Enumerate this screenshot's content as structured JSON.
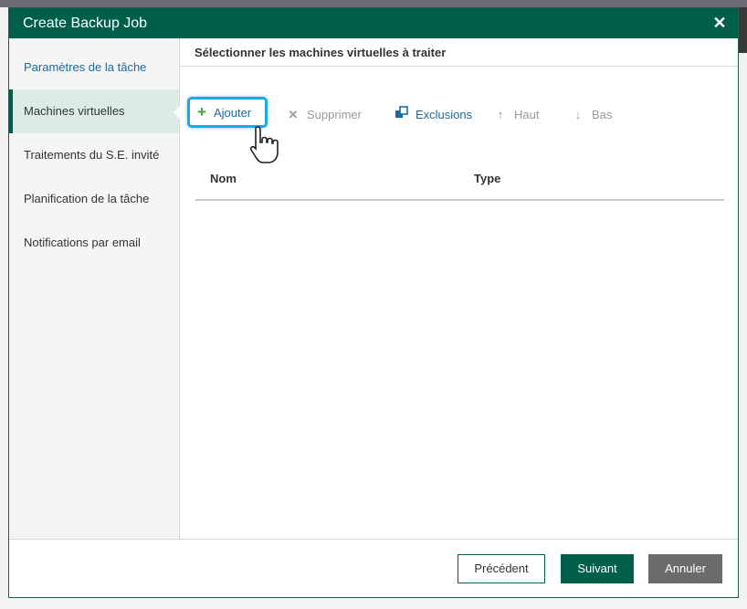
{
  "window": {
    "title": "Create Backup Job",
    "close_symbol": "✕"
  },
  "sidebar": {
    "items": [
      {
        "label": "Paramètres de la tâche"
      },
      {
        "label": "Machines virtuelles"
      },
      {
        "label": "Traitements du S.E. invité"
      },
      {
        "label": "Planification de la tâche"
      },
      {
        "label": "Notifications par email"
      }
    ]
  },
  "main": {
    "section_title": "Sélectionner les machines virtuelles à traiter",
    "toolbar": {
      "add": "Ajouter",
      "remove": "Supprimer",
      "exclusions": "Exclusions",
      "up": "Haut",
      "down": "Bas"
    },
    "table": {
      "columns": [
        "Nom",
        "Type"
      ],
      "rows": []
    }
  },
  "footer": {
    "previous": "Précédent",
    "next": "Suivant",
    "cancel": "Annuler"
  },
  "colors": {
    "accent": "#005f4b",
    "highlight": "#1ea7e1",
    "link": "#1a6aa0",
    "add_icon": "#3aa63a"
  },
  "icons": [
    "plus-icon",
    "x-icon",
    "exclusions-icon",
    "arrow-up-icon",
    "arrow-down-icon",
    "hand-cursor-icon"
  ]
}
